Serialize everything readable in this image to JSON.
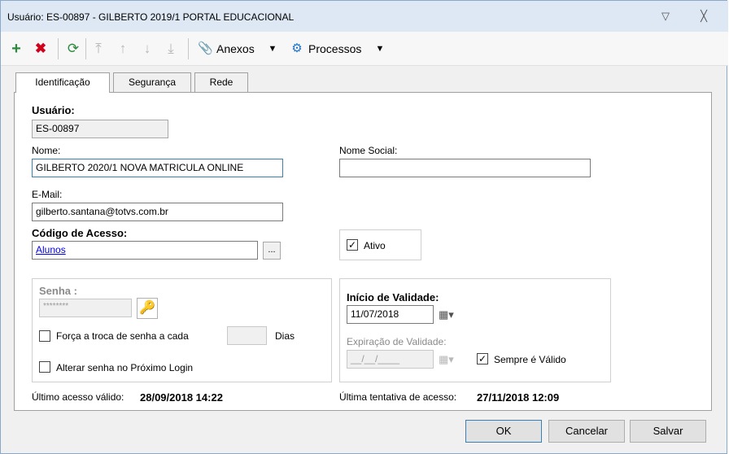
{
  "window": {
    "title": "Usuário: ES-00897 - GILBERTO 2019/1 PORTAL EDUCACIONAL"
  },
  "titlebar": {
    "pin_icon": "pin-icon",
    "close_icon": "close-icon"
  },
  "toolbar": {
    "add_icon": "plus-icon",
    "delete_icon": "x-icon",
    "refresh_icon": "refresh-icon",
    "anexos_label": "Anexos",
    "processos_label": "Processos"
  },
  "tabs": [
    {
      "label": "Identificação"
    },
    {
      "label": "Segurança"
    },
    {
      "label": "Rede"
    }
  ],
  "form": {
    "usuario_label": "Usuário:",
    "usuario_value": "ES-00897",
    "nome_label": "Nome:",
    "nome_value": "GILBERTO 2020/1 NOVA MATRICULA ONLINE",
    "nome_social_label": "Nome Social:",
    "nome_social_value": "",
    "email_label": "E-Mail:",
    "email_value": "gilberto.santana@totvs.com.br",
    "codigo_label": "Código de Acesso:",
    "codigo_value": "Alunos",
    "codigo_lookup": "...",
    "ativo_label": "Ativo",
    "ativo_checked": true
  },
  "senha": {
    "label": "Senha :",
    "value": "********",
    "forca_label": "Força a troca de senha a cada",
    "dias_value": "",
    "dias_label": "Dias",
    "alterar_label": "Alterar senha no Próximo Login"
  },
  "validade": {
    "inicio_label": "Início de Validade:",
    "inicio_value": "11/07/2018",
    "expiracao_label": "Expiração de Validade:",
    "expiracao_value": "__/__/____",
    "sempre_label": "Sempre é Válido",
    "sempre_checked": true
  },
  "status": {
    "ultimo_label": "Último acesso válido:",
    "ultimo_value": "28/09/2018 14:22",
    "tentativa_label": "Última tentativa de acesso:",
    "tentativa_value": "27/11/2018 12:09"
  },
  "buttons": {
    "ok": "OK",
    "cancel": "Cancelar",
    "save": "Salvar"
  },
  "colors": {
    "accent": "#1a73c9",
    "delete": "#d0021b",
    "add": "#2b8a3e"
  }
}
